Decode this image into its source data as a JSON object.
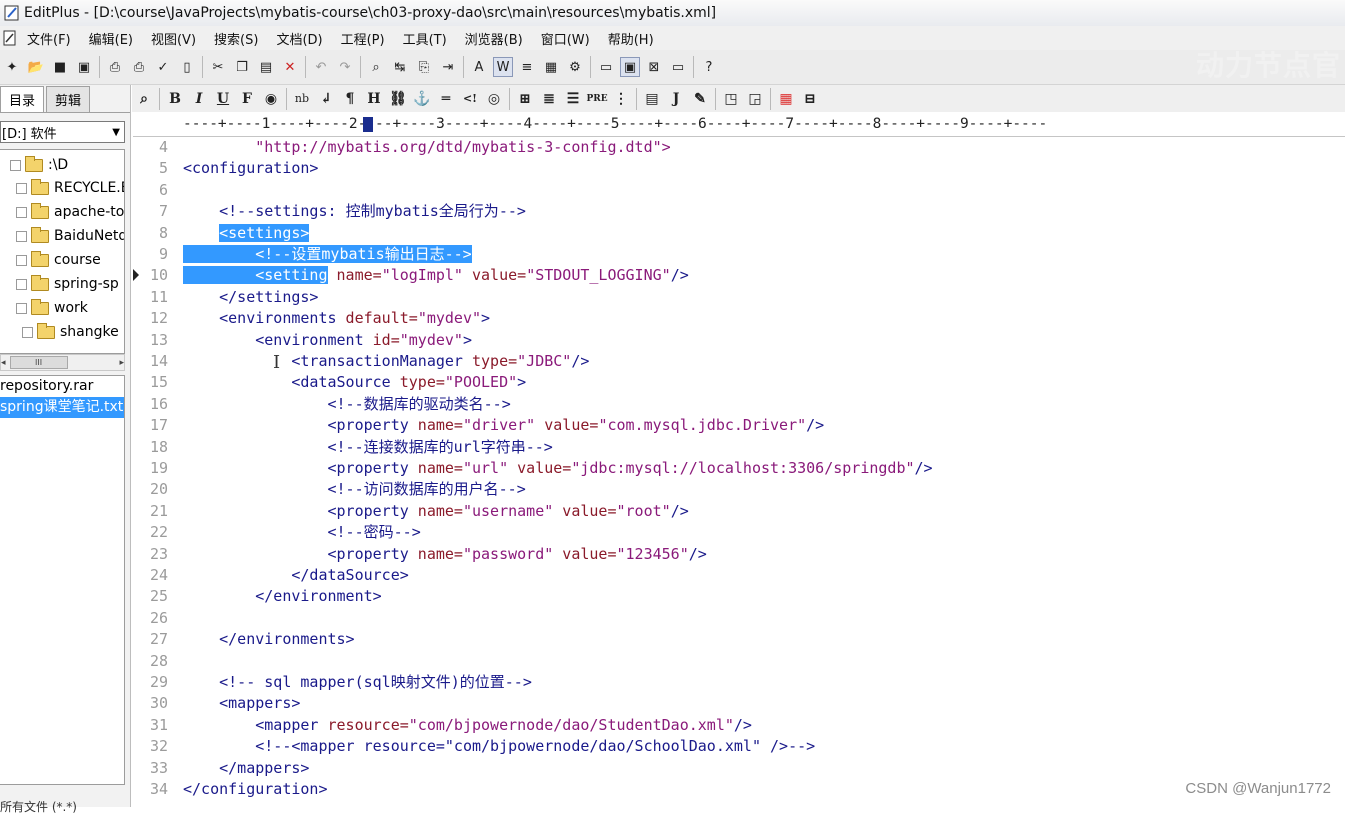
{
  "window": {
    "title": "EditPlus - [D:\\course\\JavaProjects\\mybatis-course\\ch03-proxy-dao\\src\\main\\resources\\mybatis.xml]"
  },
  "menu": [
    "文件(F)",
    "编辑(E)",
    "视图(V)",
    "搜索(S)",
    "文档(D)",
    "工程(P)",
    "工具(T)",
    "浏览器(B)",
    "窗口(W)",
    "帮助(H)"
  ],
  "watermark_top": "动力节点官",
  "sidebar": {
    "tabs": [
      "目录",
      "剪辑"
    ],
    "drive": "[D:] 软件",
    "tree": [
      ":\\D",
      "RECYCLE.BIN",
      "apache-tomcat",
      "BaiduNetdisk",
      "course",
      "spring-sp",
      "work",
      "shangke"
    ],
    "scroll_thumb": "III",
    "files": [
      "repository.rar",
      "spring课堂笔记.txt"
    ],
    "bottom": "所有文件 (*.*)"
  },
  "ruler": "----+----1----+----2----+----3----+----4----+----5----+----6----+----7----+----8----+----9----+----",
  "lines": [
    {
      "n": "4"
    },
    {
      "n": "5"
    },
    {
      "n": "6"
    },
    {
      "n": "7"
    },
    {
      "n": "8"
    },
    {
      "n": "9"
    },
    {
      "n": "10"
    },
    {
      "n": "11"
    },
    {
      "n": "12"
    },
    {
      "n": "13"
    },
    {
      "n": "14"
    },
    {
      "n": "15"
    },
    {
      "n": "16"
    },
    {
      "n": "17"
    },
    {
      "n": "18"
    },
    {
      "n": "19"
    },
    {
      "n": "20"
    },
    {
      "n": "21"
    },
    {
      "n": "22"
    },
    {
      "n": "23"
    },
    {
      "n": "24"
    },
    {
      "n": "25"
    },
    {
      "n": "26"
    },
    {
      "n": "27"
    },
    {
      "n": "28"
    },
    {
      "n": "29"
    },
    {
      "n": "30"
    },
    {
      "n": "31"
    },
    {
      "n": "32"
    },
    {
      "n": "33"
    },
    {
      "n": "34"
    }
  ],
  "code": {
    "l4": "\"http://mybatis.org/dtd/mybatis-3-config.dtd\">",
    "l5": "<configuration>",
    "l7a": "<!--settings: ",
    "l7b": "控制",
    "l7c": "mybatis",
    "l7d": "全局行为",
    "l7e": "-->",
    "l8": "<settings>",
    "l9a": "<!--",
    "l9b": "设置",
    "l9c": "mybatis",
    "l9d": "输出日志",
    "l9e": "-->",
    "l10a": "<setting",
    "l10b": " name=",
    "l10c": "\"logImpl\"",
    "l10d": " value=",
    "l10e": "\"STDOUT_LOGGING\"",
    "l10f": "/>",
    "l11": "</settings>",
    "l12a": "<environments",
    "l12b": " default=",
    "l12c": "\"mydev\"",
    "l12d": ">",
    "l13a": "<environment",
    "l13b": " id=",
    "l13c": "\"mydev\"",
    "l13d": ">",
    "l14a": "<transactionManager",
    "l14b": " type=",
    "l14c": "\"JDBC\"",
    "l14d": "/>",
    "l15a": "<dataSource",
    "l15b": " type=",
    "l15c": "\"POOLED\"",
    "l15d": ">",
    "l16a": "<!--",
    "l16b": "数据库的驱动类名",
    "l16c": "-->",
    "l17a": "<property",
    "l17b": " name=",
    "l17c": "\"driver\"",
    "l17d": " value=",
    "l17e": "\"com.mysql.jdbc.Driver\"",
    "l17f": "/>",
    "l18a": "<!--",
    "l18b": "连接数据库的",
    "l18c": "url",
    "l18d": "字符串",
    "l18e": "-->",
    "l19a": "<property",
    "l19b": " name=",
    "l19c": "\"url\"",
    "l19d": " value=",
    "l19e": "\"jdbc:mysql://localhost:3306/springdb\"",
    "l19f": "/>",
    "l20a": "<!--",
    "l20b": "访问数据库的用户名",
    "l20c": "-->",
    "l21a": "<property",
    "l21b": " name=",
    "l21c": "\"username\"",
    "l21d": " value=",
    "l21e": "\"root\"",
    "l21f": "/>",
    "l22a": "<!--",
    "l22b": "密码",
    "l22c": "-->",
    "l23a": "<property",
    "l23b": " name=",
    "l23c": "\"password\"",
    "l23d": " value=",
    "l23e": "\"123456\"",
    "l23f": "/>",
    "l24": "</dataSource>",
    "l25": "</environment>",
    "l27": "</environments>",
    "l29a": "<!-- sql mapper(sql",
    "l29b": "映射文件",
    "l29c": ")",
    "l29d": "的位置",
    "l29e": "-->",
    "l30": "<mappers>",
    "l31a": "<mapper",
    "l31b": " resource=",
    "l31c": "\"com/bjpowernode/dao/StudentDao.xml\"",
    "l31d": "/>",
    "l32": "<!--<mapper resource=\"com/bjpowernode/dao/SchoolDao.xml\" />-->",
    "l33": "</mappers>",
    "l34": "</configuration>"
  },
  "csdn_watermark": "CSDN @Wanjun1772"
}
